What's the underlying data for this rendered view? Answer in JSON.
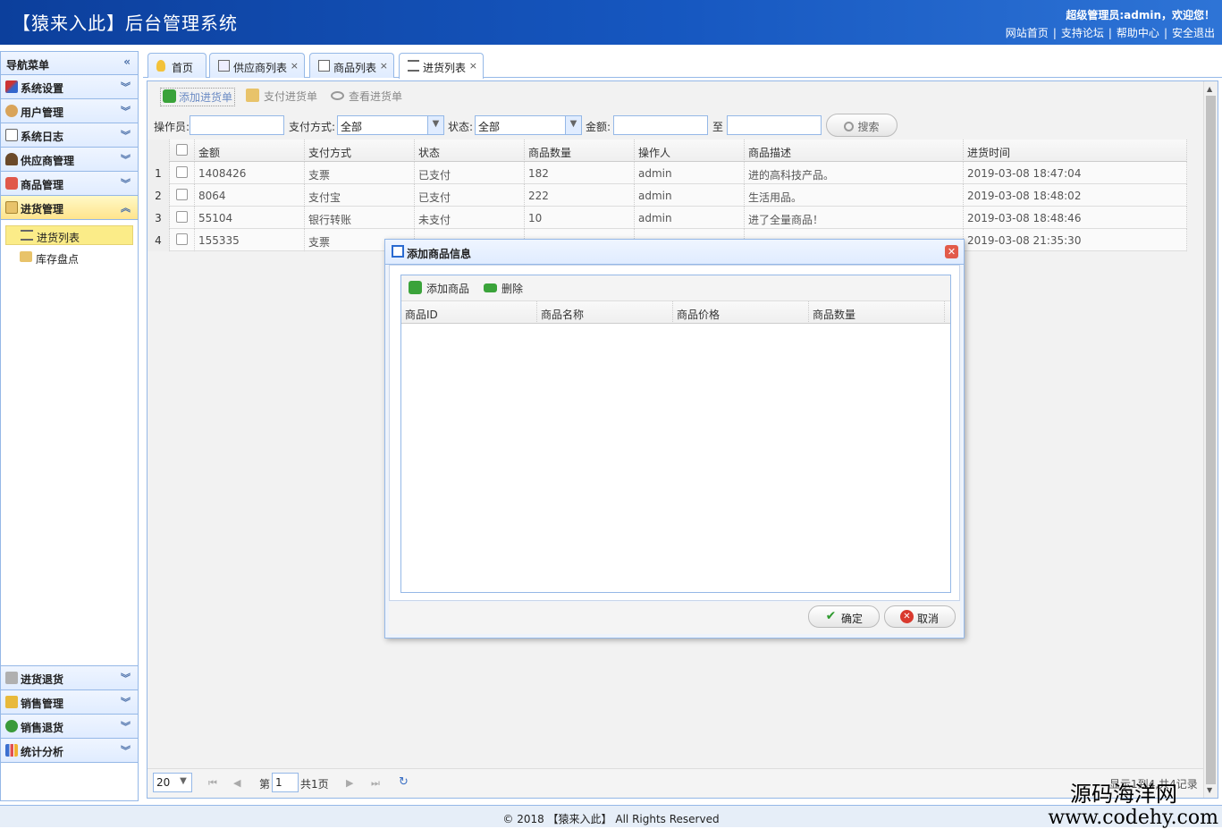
{
  "header": {
    "title": "【猿来入此】后台管理系统",
    "welcome": "超级管理员:admin，欢迎您！",
    "links": [
      "网站首页",
      "支持论坛",
      "帮助中心",
      "安全退出"
    ]
  },
  "sidebar": {
    "title": "导航菜单",
    "groups": [
      {
        "label": "系统设置",
        "icon": "tools-icon"
      },
      {
        "label": "用户管理",
        "icon": "users-icon"
      },
      {
        "label": "系统日志",
        "icon": "log-icon"
      },
      {
        "label": "供应商管理",
        "icon": "supplier-icon"
      },
      {
        "label": "商品管理",
        "icon": "goods-icon"
      },
      {
        "label": "进货管理",
        "icon": "purchase-icon",
        "active": true
      },
      {
        "label": "进货退货",
        "icon": "return-icon"
      },
      {
        "label": "销售管理",
        "icon": "sales-icon"
      },
      {
        "label": "销售退货",
        "icon": "sales-return-icon"
      },
      {
        "label": "统计分析",
        "icon": "chart-icon"
      }
    ],
    "subitems": [
      {
        "label": "进货列表",
        "active": true
      },
      {
        "label": "库存盘点"
      }
    ]
  },
  "tabs": [
    {
      "label": "首页"
    },
    {
      "label": "供应商列表"
    },
    {
      "label": "商品列表"
    },
    {
      "label": "进货列表",
      "active": true
    }
  ],
  "toolbar": {
    "add": "添加进货单",
    "pay": "支付进货单",
    "view": "查看进货单"
  },
  "filter": {
    "operator_label": "操作员:",
    "operator_value": "",
    "pay_label": "支付方式:",
    "pay_value": "全部",
    "status_label": "状态:",
    "status_value": "全部",
    "amount_label": "金额:",
    "amount_from": "",
    "to_label": "至",
    "amount_to": "",
    "search": "搜索"
  },
  "grid": {
    "columns": [
      "金额",
      "支付方式",
      "状态",
      "商品数量",
      "操作人",
      "商品描述",
      "进货时间"
    ],
    "rows": [
      {
        "no": "1",
        "amount": "1408426",
        "pay": "支票",
        "status": "已支付",
        "qty": "182",
        "op": "admin",
        "desc": "进的高科技产品。",
        "time": "2019-03-08 18:47:04"
      },
      {
        "no": "2",
        "amount": "8064",
        "pay": "支付宝",
        "status": "已支付",
        "qty": "222",
        "op": "admin",
        "desc": "生活用品。",
        "time": "2019-03-08 18:48:02"
      },
      {
        "no": "3",
        "amount": "55104",
        "pay": "银行转账",
        "status": "未支付",
        "qty": "10",
        "op": "admin",
        "desc": "进了全量商品！",
        "time": "2019-03-08 18:48:46"
      },
      {
        "no": "4",
        "amount": "155335",
        "pay": "支票",
        "status": "",
        "qty": "",
        "op": "",
        "desc": "",
        "time": "2019-03-08 21:35:30"
      }
    ]
  },
  "pager": {
    "size": "20",
    "page_prefix": "第",
    "page": "1",
    "total": "共1页",
    "records": "显示1到4,共4记录"
  },
  "dialog": {
    "title": "添加商品信息",
    "add": "添加商品",
    "remove": "删除",
    "columns": [
      "商品ID",
      "商品名称",
      "商品价格",
      "商品数量"
    ],
    "ok": "确定",
    "cancel": "取消"
  },
  "footer": "© 2018 【猿来入此】 All Rights Reserved",
  "watermark": {
    "line1": "源码海洋网",
    "line2": "www.codehy.com"
  }
}
